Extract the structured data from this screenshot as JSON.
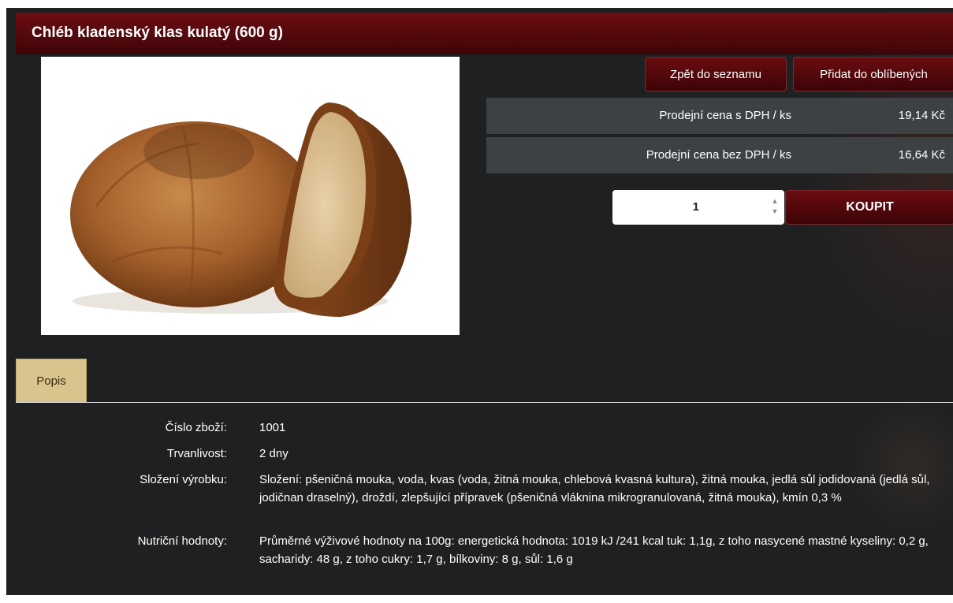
{
  "product": {
    "title": "Chléb kladenský klas kulatý (600 g)"
  },
  "actions": {
    "back_label": "Zpět do seznamu",
    "favorite_label": "Přidat do oblíbených",
    "buy_label": "KOUPIT"
  },
  "prices": [
    {
      "label": "Prodejní cena s DPH / ks",
      "value": "19,14 Kč"
    },
    {
      "label": "Prodejní cena bez DPH / ks",
      "value": "16,64 Kč"
    }
  ],
  "quantity": {
    "value": "1"
  },
  "tabs": [
    {
      "label": "Popis",
      "active": true
    }
  ],
  "details": [
    {
      "label": "Číslo zboží:",
      "value": "1001"
    },
    {
      "label": "Trvanlivost:",
      "value": "2 dny"
    },
    {
      "label": "Složení výrobku:",
      "value": "Složení: pšeničná mouka, voda, kvas (voda, žitná mouka, chlebová kvasná kultura), žitná mouka, jedlá sůl jodidovaná (jedlá sůl, jodičnan draselný), droždí, zlepšující přípravek (pšeničná vláknina mikrogranulovaná, žitná mouka), kmín 0,3 %"
    },
    {
      "label": "Nutriční hodnoty:",
      "value": "Průměrné výživové hodnoty na 100g: energetická hodnota: 1019 kJ /241 kcal tuk: 1,1g, z toho nasycené mastné kyseliny: 0,2 g, sacharidy: 48 g, z toho cukry: 1,7 g, bílkoviny: 8 g, sůl: 1,6 g"
    }
  ],
  "colors": {
    "title_bar": "#5a0a0e",
    "background": "#1e2022",
    "price_row": "#3e4144",
    "tab_active": "#d8c48c"
  }
}
